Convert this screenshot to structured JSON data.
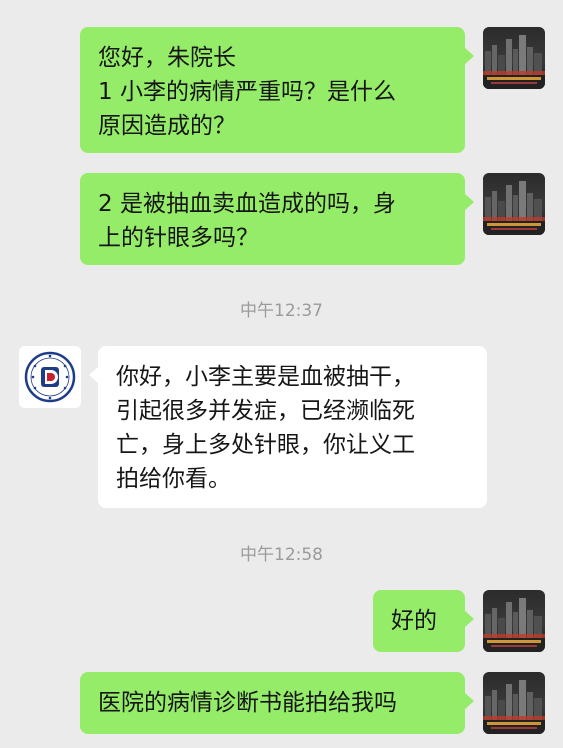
{
  "conversation": {
    "messages": [
      {
        "sender": "me",
        "lines": [
          "您好，朱院长",
          "1 小李的病情严重吗？是什么",
          "原因造成的？"
        ]
      },
      {
        "sender": "me",
        "lines": [
          "2 是被抽血卖血造成的吗，身",
          "上的针眼多吗？"
        ]
      },
      {
        "sender": "other",
        "lines": [
          "你好，小李主要是血被抽干，",
          "引起很多并发症，已经濒临死",
          "亡，身上多处针眼，你让义工",
          "拍给你看。"
        ]
      },
      {
        "sender": "me",
        "lines": [
          "好的"
        ]
      },
      {
        "sender": "me",
        "lines": [
          "医院的病情诊断书能拍给我吗"
        ]
      }
    ],
    "timestamps": [
      "中午12:37",
      "中午12:58"
    ]
  },
  "colors": {
    "background": "#ebebeb",
    "my_bubble": "#95ec69",
    "their_bubble": "#ffffff",
    "timestamp_text": "#9b9b9b",
    "hospital_logo_red": "#c8202c",
    "hospital_logo_navy": "#1f3c88"
  },
  "icons": {
    "my_avatar": "city-skyline-avatar-icon",
    "their_avatar": "hospital-logo-avatar-icon"
  }
}
